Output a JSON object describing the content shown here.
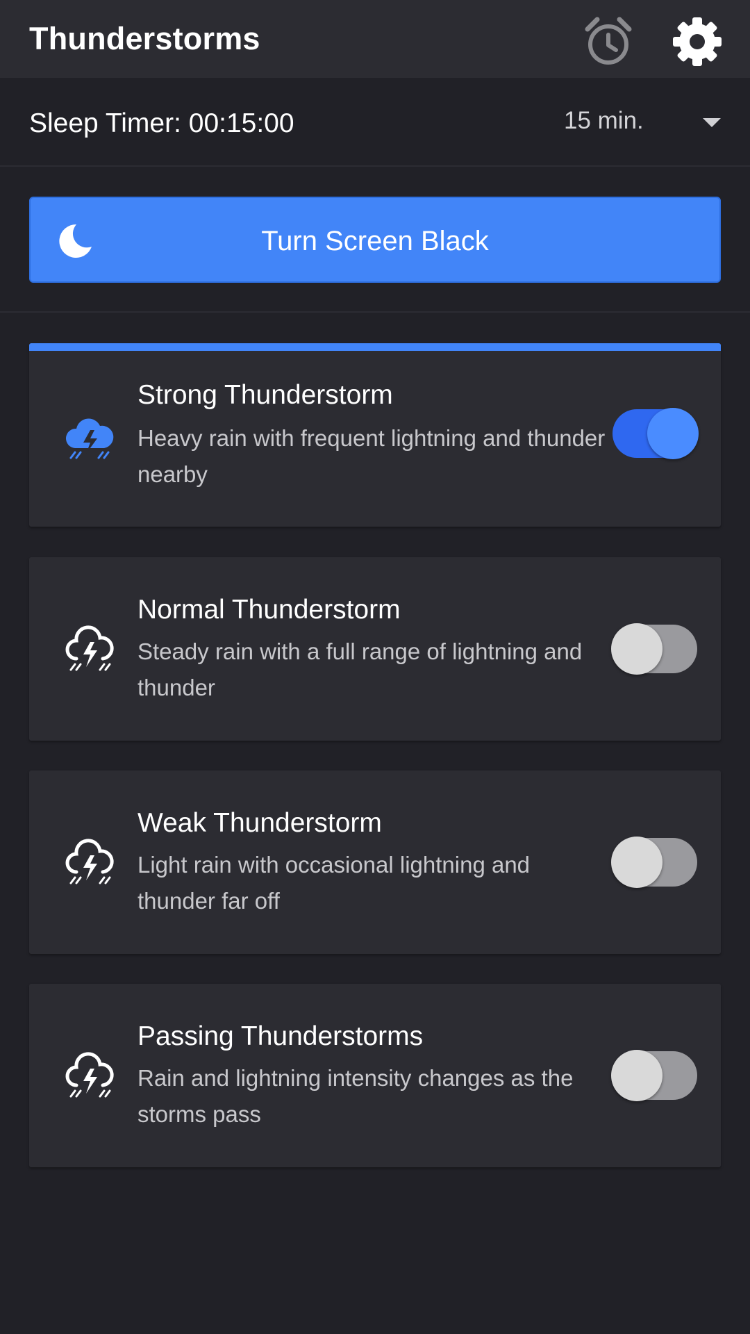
{
  "app_bar": {
    "title": "Thunderstorms",
    "alarm_icon": "alarm-clock-icon",
    "settings_icon": "gear-icon"
  },
  "sleep_timer": {
    "label": "Sleep Timer: 00:15:00",
    "selected": "15 min."
  },
  "black_button": {
    "label": "Turn Screen Black",
    "icon": "moon-icon"
  },
  "sounds": [
    {
      "title": "Strong Thunderstorm",
      "description": "Heavy rain with frequent lightning and thunder nearby",
      "enabled": true,
      "icon": "thunderstorm-cloud-icon"
    },
    {
      "title": "Normal Thunderstorm",
      "description": "Steady rain with a full range of lightning and thunder",
      "enabled": false,
      "icon": "thunderstorm-cloud-icon"
    },
    {
      "title": "Weak Thunderstorm",
      "description": "Light rain with occasional lightning and thunder far off",
      "enabled": false,
      "icon": "thunderstorm-cloud-icon"
    },
    {
      "title": "Passing Thunderstorms",
      "description": "Rain and lightning intensity changes as the storms pass",
      "enabled": false,
      "icon": "thunderstorm-cloud-icon"
    }
  ],
  "colors": {
    "accent": "#4285f8",
    "toggle_on": "#2f68f0",
    "background": "#212127",
    "surface": "#2c2c32"
  }
}
